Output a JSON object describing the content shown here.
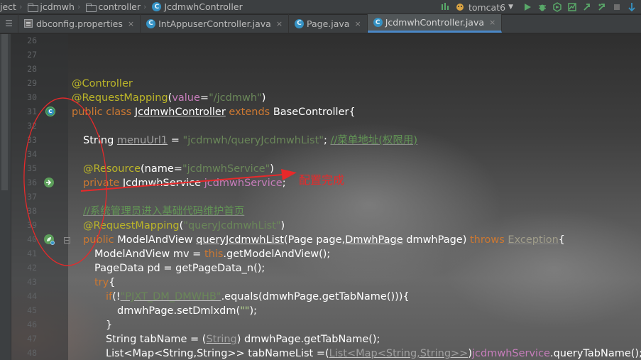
{
  "breadcrumb": [
    {
      "label": "ject",
      "icon": "none"
    },
    {
      "label": "jcdmwh",
      "icon": "folder-icon"
    },
    {
      "label": "controller",
      "icon": "folder-icon"
    },
    {
      "label": "JcdmwhController",
      "icon": "class-icon"
    }
  ],
  "toolbar": {
    "run_config_label": "tomcat6",
    "icons": [
      "build-icon",
      "tomcat-icon",
      "dropdown-icon",
      "run-icon",
      "debug-icon",
      "coverage-icon",
      "profile-icon",
      "attach-icon",
      "stop-icon",
      "vcs-icon"
    ]
  },
  "tabs": [
    {
      "label": "dbconfig.properties",
      "close": "×",
      "icon": "properties-file-icon",
      "active": false
    },
    {
      "label": "IntAppuserController.java",
      "close": "×",
      "icon": "class-icon",
      "active": false
    },
    {
      "label": "Page.java",
      "close": "×",
      "icon": "class-icon",
      "active": false
    },
    {
      "label": "JcdmwhController.java",
      "close": "×",
      "icon": "class-icon",
      "active": true
    }
  ],
  "line_numbers": [
    "26",
    "27",
    "28",
    "29",
    "30",
    "31",
    "32",
    "33",
    "34",
    "35",
    "36",
    "37",
    "38",
    "39",
    "40",
    "41",
    "42",
    "43",
    "44",
    "45",
    "46",
    "47",
    "48"
  ],
  "code": {
    "l29_controller": "@Controller",
    "l30_requestmapping": "@RequestMapping",
    "l30_open": "(",
    "l30_value_key": "value",
    "l30_eq": "=",
    "l30_value": "\"/jcdmwh\"",
    "l30_close": ")",
    "l31_public_class": "public class ",
    "l31_class_name": "JcdmwhController",
    "l31_extends": " extends ",
    "l31_base": "BaseController{",
    "l33_type": "String ",
    "l33_name": "menuUrl1",
    "l33_eq": " = ",
    "l33_value": "\"jcdmwh/queryJcdmwhList\"",
    "l33_semi": "; ",
    "l33_comment": "//菜单地址(权限用)",
    "l35_resource": "@Resource",
    "l35_open": "(",
    "l35_name_key": "name",
    "l35_eq": "=",
    "l35_value": "\"jcdmwhService\"",
    "l35_close": ")",
    "l36_private": "private ",
    "l36_type": "JcdmwhService ",
    "l36_field": "jcdmwhService",
    "l36_semi": ";",
    "l38_comment": "//系统管理员进入基础代码维护首页",
    "l39_mapping": "@RequestMapping",
    "l39_open": "(",
    "l39_value": "\"queryJcdmwhList\"",
    "l39_close": ")",
    "l40_public": "public ",
    "l40_type": "ModelAndView ",
    "l40_method": "queryJcdmwhList",
    "l40_params_a": "(Page page,",
    "l40_param_type": "DmwhPage",
    "l40_params_b": " dmwhPage) ",
    "l40_throws": "throws ",
    "l40_exception": "Exception",
    "l40_brace": "{",
    "l41_a": "ModelAndView mv = ",
    "l41_this": "this",
    "l41_b": ".getModelAndView();",
    "l42": "PageData pd = getPageData_n();",
    "l43_try": "try",
    "l43_brace": "{",
    "l44_if": "if",
    "l44_a": "(!",
    "l44_str": "\"PJXT_DM_DMWHB\"",
    "l44_b": ".equals(dmwhPage.getTabName())){",
    "l45_a": "dmwhPage.setDmlxdm(",
    "l45_str": "\"\"",
    "l45_b": ");",
    "l46": "}",
    "l47_a": "String tabName = (",
    "l47_cast": "String",
    "l47_b": ") dmwhPage.getTabName();",
    "l48_a": "List<Map<String,String>> tabNameList =(",
    "l48_cast": "List<Map<String,String>>",
    "l48_b": ")",
    "l48_field": "jcdmwhService",
    "l48_c": ".queryTabName();"
  },
  "annotation": {
    "text": "配置完成",
    "color": "#e8292a"
  },
  "colors": {
    "annotation": "#bbb529",
    "keyword": "#cc7832",
    "string": "#6a8759",
    "comment": "#629755",
    "field": "#c77dbb",
    "accent_tab": "#4a88c7"
  }
}
